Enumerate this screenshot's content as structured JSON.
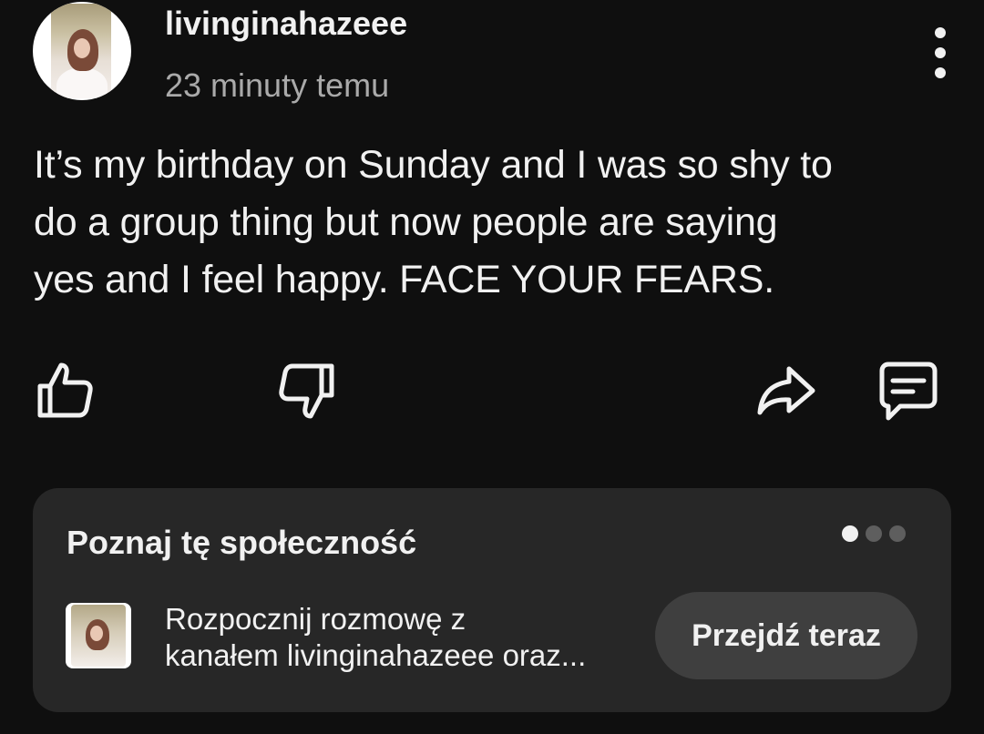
{
  "post": {
    "author": "livinginahazeee",
    "time": "23 minuty temu",
    "text_lines": [
      "It’s my birthday on Sunday and I was so shy to",
      "do a group thing but now people are saying",
      "yes and I feel happy. FACE YOUR FEARS."
    ],
    "icons": {
      "more": "more-vert-icon",
      "like": "thumbs-up-icon",
      "dislike": "thumbs-down-icon",
      "share": "share-icon",
      "comment": "comment-icon"
    }
  },
  "community_card": {
    "title": "Poznaj tę społeczność",
    "description_lines": [
      "Rozpocznij rozmowę z",
      "kanałem livinginahazeee oraz..."
    ],
    "button_label": "Przejdź teraz",
    "pagination": {
      "total": 3,
      "active": 1
    }
  },
  "colors": {
    "background": "#0f0f0f",
    "card": "#272727",
    "text": "#f1f1f1",
    "secondary_text": "#aaaaaa",
    "button": "#3f3f3f"
  }
}
